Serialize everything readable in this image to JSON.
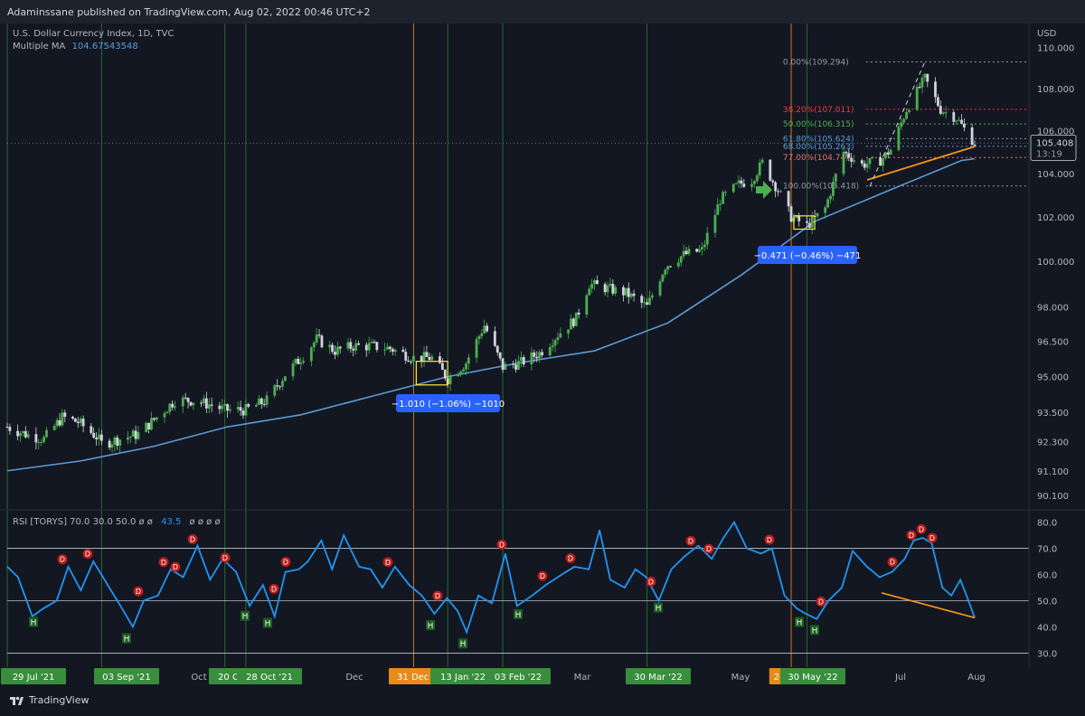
{
  "header": {
    "published": "Adaminssane published on TradingView.com, Aug 02, 2022 00:46 UTC+2"
  },
  "legend": {
    "symbol": "U.S. Dollar Currency Index, 1D, TVC",
    "ma_name": "Multiple MA",
    "ma_value": "104.67543548",
    "rsi_line": "RSI [TORYS]  70.0  30.0  50.0  ø  ø",
    "rsi_value": "43.5",
    "rsi_tail": "ø  ø  ø  ø"
  },
  "branding": {
    "logo_text": "TradingView"
  },
  "colors": {
    "up": "#4caf50",
    "down": "#d1d4dc",
    "ma": "#5b9bd5",
    "rsi": "#2196f3",
    "orange": "#f7931a",
    "vline_green": "#2e7d32",
    "vline_orange": "#f7931a"
  },
  "chart_data": {
    "type": "candlestick",
    "currency": "USD",
    "price_axis": {
      "labels": [
        "110.000",
        "108.000",
        "106.000",
        "104.000",
        "102.000",
        "100.000",
        "98.000",
        "96.500",
        "95.000",
        "93.500",
        "92.300",
        "91.100",
        "90.100"
      ],
      "ylim": [
        89.6,
        111.0
      ],
      "scale": "log"
    },
    "current_price": "105.408",
    "countdown": "13:19",
    "x_axis": {
      "labels": [
        "29 Jul '21",
        "03 Sep '21",
        "Oct",
        "20 Oct '21",
        "28 Oct '21",
        "Dec",
        "31 Dec '21",
        "13 Jan '22",
        "03 Feb '22",
        "Mar",
        "30 Mar '22",
        "May",
        "24",
        "30 May '22",
        "Jul",
        "Aug"
      ],
      "range": [
        "2021-07-29",
        "2022-08-02"
      ]
    },
    "price_path": [
      [
        "2021-07-29",
        92.9
      ],
      [
        "2021-08-05",
        92.6
      ],
      [
        "2021-08-12",
        92.4
      ],
      [
        "2021-08-19",
        93.3
      ],
      [
        "2021-08-25",
        93.1
      ],
      [
        "2021-09-01",
        92.5
      ],
      [
        "2021-09-03",
        92.2
      ],
      [
        "2021-09-10",
        92.4
      ],
      [
        "2021-09-17",
        92.6
      ],
      [
        "2021-09-24",
        93.3
      ],
      [
        "2021-10-01",
        94.0
      ],
      [
        "2021-10-08",
        94.0
      ],
      [
        "2021-10-15",
        93.8
      ],
      [
        "2021-10-20",
        93.6
      ],
      [
        "2021-10-28",
        93.6
      ],
      [
        "2021-11-05",
        94.0
      ],
      [
        "2021-11-12",
        95.1
      ],
      [
        "2021-11-19",
        95.9
      ],
      [
        "2021-11-24",
        96.6
      ],
      [
        "2021-12-01",
        96.1
      ],
      [
        "2021-12-08",
        96.3
      ],
      [
        "2021-12-15",
        96.3
      ],
      [
        "2021-12-22",
        96.2
      ],
      [
        "2021-12-31",
        95.8
      ],
      [
        "2022-01-07",
        95.8
      ],
      [
        "2022-01-13",
        94.9
      ],
      [
        "2022-01-20",
        95.6
      ],
      [
        "2022-01-27",
        97.2
      ],
      [
        "2022-02-03",
        95.4
      ],
      [
        "2022-02-10",
        95.6
      ],
      [
        "2022-02-17",
        96.0
      ],
      [
        "2022-02-24",
        96.8
      ],
      [
        "2022-03-03",
        97.5
      ],
      [
        "2022-03-08",
        99.0
      ],
      [
        "2022-03-15",
        98.8
      ],
      [
        "2022-03-22",
        98.6
      ],
      [
        "2022-03-30",
        98.0
      ],
      [
        "2022-04-06",
        99.8
      ],
      [
        "2022-04-13",
        100.3
      ],
      [
        "2022-04-20",
        100.5
      ],
      [
        "2022-04-27",
        102.8
      ],
      [
        "2022-05-04",
        103.5
      ],
      [
        "2022-05-09",
        103.7
      ],
      [
        "2022-05-13",
        104.5
      ],
      [
        "2022-05-20",
        103.0
      ],
      [
        "2022-05-24",
        102.0
      ],
      [
        "2022-05-30",
        101.6
      ],
      [
        "2022-06-06",
        102.4
      ],
      [
        "2022-06-13",
        105.0
      ],
      [
        "2022-06-20",
        104.4
      ],
      [
        "2022-06-27",
        104.6
      ],
      [
        "2022-07-01",
        105.1
      ],
      [
        "2022-07-07",
        107.0
      ],
      [
        "2022-07-14",
        108.5
      ],
      [
        "2022-07-20",
        107.0
      ],
      [
        "2022-07-26",
        106.6
      ],
      [
        "2022-08-02",
        105.4
      ]
    ],
    "moving_average": [
      [
        "2021-07-29",
        91.1
      ],
      [
        "2021-08-26",
        91.5
      ],
      [
        "2021-09-23",
        92.1
      ],
      [
        "2021-10-21",
        92.9
      ],
      [
        "2021-11-18",
        93.4
      ],
      [
        "2021-12-16",
        94.2
      ],
      [
        "2022-01-13",
        95.0
      ],
      [
        "2022-02-10",
        95.6
      ],
      [
        "2022-03-10",
        96.1
      ],
      [
        "2022-04-07",
        97.3
      ],
      [
        "2022-05-05",
        99.4
      ],
      [
        "2022-06-02",
        101.8
      ],
      [
        "2022-06-30",
        103.2
      ],
      [
        "2022-07-28",
        104.6
      ],
      [
        "2022-08-02",
        104.68
      ]
    ],
    "fib_levels": [
      {
        "label": "0.00%(109.294)",
        "price": 109.294,
        "color": "#9598a1"
      },
      {
        "label": "38.20%(107.011)",
        "price": 107.011,
        "color": "#f23645"
      },
      {
        "label": "50.00%(106.315)",
        "price": 106.315,
        "color": "#4caf50"
      },
      {
        "label": "61.80%(105.624)",
        "price": 105.624,
        "color": "#5b9bd5"
      },
      {
        "label": "68.00%(105.263)",
        "price": 105.263,
        "color": "#5b9bd5"
      },
      {
        "label": "77.00%(104.74)",
        "price": 104.74,
        "color": "#e57373"
      },
      {
        "label": "100.00%(103.418)",
        "price": 103.418,
        "color": "#9598a1"
      }
    ],
    "measure_labels": [
      "−1.010 (−1.06%) −1010",
      "−0.471 (−0.46%) −471"
    ],
    "vertical_markers": [
      "2021-07-29",
      "2021-09-03",
      "2021-10-20",
      "2021-10-28",
      "2022-01-13",
      "2022-02-03",
      "2022-03-30",
      "2022-05-30",
      "2021-12-31",
      "2022-05-24"
    ],
    "rsi": {
      "levels": {
        "upper": 70,
        "lower": 30,
        "mid": 50
      },
      "axis_labels": [
        "80.0",
        "70.0",
        "60.0",
        "50.0",
        "40.0",
        "30.0"
      ],
      "ylim": [
        26,
        84
      ],
      "values": [
        [
          0,
          63
        ],
        [
          12,
          59
        ],
        [
          28,
          44
        ],
        [
          40,
          47
        ],
        [
          55,
          50
        ],
        [
          68,
          63
        ],
        [
          82,
          54
        ],
        [
          96,
          65
        ],
        [
          112,
          56
        ],
        [
          128,
          47
        ],
        [
          140,
          40
        ],
        [
          152,
          50
        ],
        [
          168,
          52
        ],
        [
          182,
          62
        ],
        [
          196,
          59
        ],
        [
          212,
          71
        ],
        [
          226,
          58
        ],
        [
          240,
          66
        ],
        [
          255,
          61
        ],
        [
          270,
          48
        ],
        [
          285,
          56
        ],
        [
          298,
          44
        ],
        [
          310,
          61
        ],
        [
          325,
          62
        ],
        [
          335,
          65
        ],
        [
          350,
          73
        ],
        [
          362,
          62
        ],
        [
          375,
          75
        ],
        [
          392,
          63
        ],
        [
          405,
          62
        ],
        [
          418,
          55
        ],
        [
          432,
          63
        ],
        [
          448,
          56
        ],
        [
          462,
          52
        ],
        [
          476,
          45
        ],
        [
          490,
          51
        ],
        [
          502,
          46
        ],
        [
          512,
          38
        ],
        [
          525,
          52
        ],
        [
          540,
          49
        ],
        [
          555,
          68
        ],
        [
          568,
          48
        ],
        [
          585,
          52
        ],
        [
          600,
          56
        ],
        [
          618,
          60
        ],
        [
          632,
          63
        ],
        [
          648,
          62
        ],
        [
          660,
          77
        ],
        [
          672,
          58
        ],
        [
          688,
          55
        ],
        [
          700,
          62
        ],
        [
          712,
          59
        ],
        [
          726,
          50
        ],
        [
          740,
          62
        ],
        [
          755,
          67
        ],
        [
          770,
          71
        ],
        [
          785,
          66
        ],
        [
          798,
          74
        ],
        [
          810,
          80
        ],
        [
          824,
          70
        ],
        [
          840,
          68
        ],
        [
          852,
          70
        ],
        [
          866,
          52
        ],
        [
          880,
          47
        ],
        [
          890,
          45
        ],
        [
          902,
          43
        ],
        [
          915,
          50
        ],
        [
          930,
          55
        ],
        [
          942,
          69
        ],
        [
          958,
          63
        ],
        [
          972,
          59
        ],
        [
          986,
          61
        ],
        [
          1000,
          66
        ],
        [
          1010,
          73
        ],
        [
          1020,
          74
        ],
        [
          1030,
          72
        ],
        [
          1042,
          55
        ],
        [
          1052,
          52
        ],
        [
          1062,
          58
        ],
        [
          1070,
          51
        ],
        [
          1078,
          43.5
        ]
      ],
      "orange_line": [
        [
          975,
          53
        ],
        [
          1078,
          43.5
        ]
      ],
      "markers": [
        {
          "x": 37,
          "type": "H"
        },
        {
          "x": 140,
          "type": "H"
        },
        {
          "x": 271,
          "type": "H"
        },
        {
          "x": 296,
          "type": "H"
        },
        {
          "x": 476,
          "type": "H"
        },
        {
          "x": 512,
          "type": "H"
        },
        {
          "x": 573,
          "type": "H"
        },
        {
          "x": 728,
          "type": "H"
        },
        {
          "x": 884,
          "type": "H"
        },
        {
          "x": 901,
          "type": "H"
        },
        {
          "x": 69,
          "type": "D"
        },
        {
          "x": 97,
          "type": "D"
        },
        {
          "x": 153,
          "type": "D"
        },
        {
          "x": 181,
          "type": "D"
        },
        {
          "x": 194,
          "type": "D"
        },
        {
          "x": 213,
          "type": "D"
        },
        {
          "x": 249,
          "type": "D"
        },
        {
          "x": 303,
          "type": "D"
        },
        {
          "x": 316,
          "type": "D"
        },
        {
          "x": 429,
          "type": "D"
        },
        {
          "x": 484,
          "type": "D"
        },
        {
          "x": 555,
          "type": "D"
        },
        {
          "x": 600,
          "type": "D"
        },
        {
          "x": 631,
          "type": "D"
        },
        {
          "x": 720,
          "type": "D"
        },
        {
          "x": 764,
          "type": "D"
        },
        {
          "x": 784,
          "type": "D"
        },
        {
          "x": 851,
          "type": "D"
        },
        {
          "x": 908,
          "type": "D"
        },
        {
          "x": 987,
          "type": "D"
        },
        {
          "x": 1008,
          "type": "D"
        },
        {
          "x": 1019,
          "type": "D"
        },
        {
          "x": 1031,
          "type": "D"
        }
      ]
    }
  }
}
